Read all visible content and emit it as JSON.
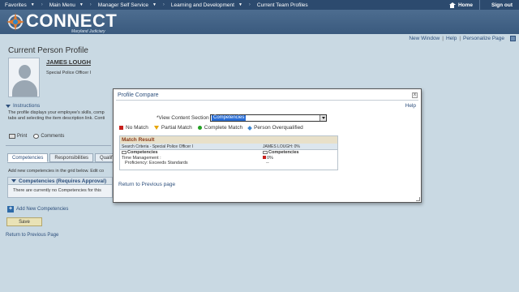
{
  "topnav": {
    "favorites": "Favorites",
    "main_menu": "Main Menu",
    "manager_self_service": "Manager Self Service",
    "learning_development": "Learning and Development",
    "current_team_profiles": "Current Team Profiles",
    "home": "Home",
    "sign_out": "Sign out"
  },
  "banner": {
    "logo": "CONNECT",
    "sub": "Maryland Judiciary"
  },
  "utilbar": {
    "new_window": "New Window",
    "help": "Help",
    "personalize": "Personalize Page"
  },
  "page": {
    "title": "Current Person Profile",
    "person_name": "JAMES LOUGH",
    "person_job": "Special Police Officer I",
    "instructions_label": "Instructions",
    "instructions_line1": "The profile displays your employee's skills, comp",
    "instructions_line2": "tabs and selecting the item description link. Conti",
    "print": "Print",
    "comments": "Comments",
    "tabs": [
      "Competencies",
      "Responsibilities",
      "Qualif"
    ],
    "grid_note": "Add new competencies in the grid below. Edit co",
    "grid_header": "Competencies (Requires Approval)",
    "grid_empty": "There are currently no Competencies for this",
    "add_new": "Add New Competencies",
    "save": "Save",
    "return": "Return to Previous Page"
  },
  "modal": {
    "title": "Profile Compare",
    "close": "x",
    "help": "Help",
    "section_label": "*View Content Section",
    "section_value": "Competencies",
    "legend": {
      "no_match": "No Match",
      "partial": "Partial Match",
      "complete": "Complete Match",
      "overqualified": "Person Overqualified"
    },
    "table": {
      "title": "Match Result",
      "col1": "Search Criteria - Special Police Officer I",
      "col2": "JAMES LOUGH: 0%",
      "r1c1": "Competencies",
      "r1c2": "Competencies",
      "r2c1": "Time Management :",
      "r2c2": "0%",
      "r3c1": "Proficiency: Exceeds Standards",
      "r3c2": "--"
    },
    "return": "Return to Previous page"
  },
  "colors": {
    "nav_bg": "#2c4a6e",
    "banner_bg": "#3a5a7e",
    "link": "#2d4f7c",
    "no_match": "#c8201c",
    "partial": "#e7a500",
    "complete": "#22a022",
    "overqualified": "#3b85d0"
  }
}
